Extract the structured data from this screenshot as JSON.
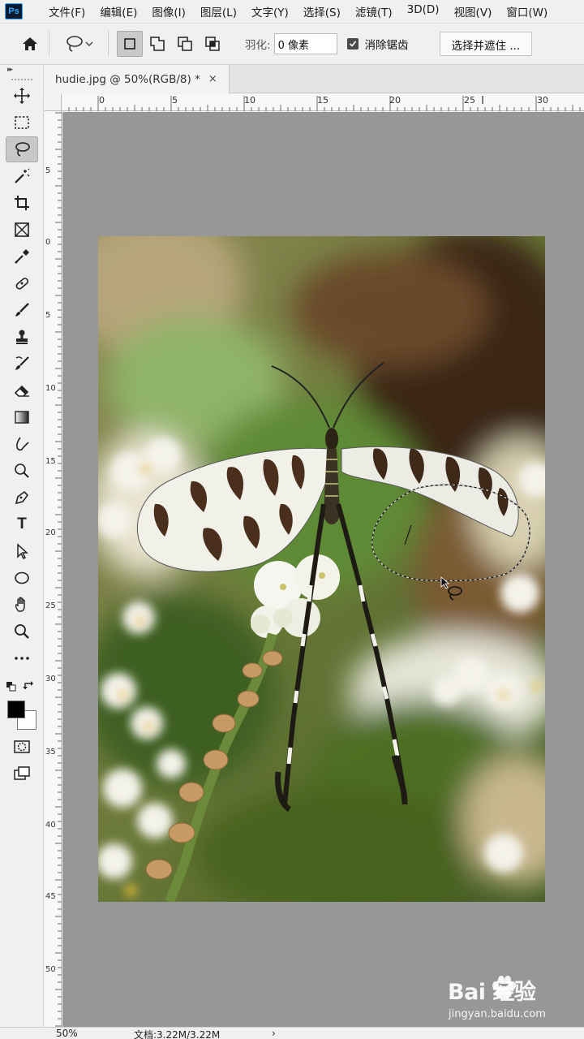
{
  "app": {
    "logo": "Ps"
  },
  "menu": {
    "items": [
      "文件(F)",
      "编辑(E)",
      "图像(I)",
      "图层(L)",
      "文字(Y)",
      "选择(S)",
      "滤镜(T)",
      "3D(D)",
      "视图(V)",
      "窗口(W)"
    ]
  },
  "options": {
    "home_icon": "home-icon",
    "tool_icon": "lasso-icon",
    "selection_modes": [
      "new-selection-icon",
      "add-to-selection-icon",
      "subtract-from-selection-icon",
      "intersect-selection-icon"
    ],
    "active_mode": "new-selection-icon",
    "feather_label": "羽化:",
    "feather_value": "0 像素",
    "antialias_checked": true,
    "antialias_label": "消除锯齿",
    "select_mask_button": "选择并遮住 ..."
  },
  "toolbar": {
    "grip_icon": "panel-collapse-icon",
    "tools": [
      "move-icon",
      "marquee-icon",
      "lasso-icon",
      "magic-wand-icon",
      "crop-icon",
      "frame-icon",
      "eyedropper-icon",
      "healing-brush-icon",
      "brush-icon",
      "clone-stamp-icon",
      "history-brush-icon",
      "eraser-icon",
      "gradient-icon",
      "blur-icon",
      "dodge-icon",
      "pen-icon",
      "type-icon",
      "path-selection-icon",
      "ellipse-icon",
      "hand-icon",
      "zoom-icon",
      "more-tools-icon"
    ],
    "active_tool": "lasso-icon",
    "type_tool_glyph": "T",
    "foreground_color": "#000000",
    "background_color": "#ffffff",
    "bottom_tools": [
      "quick-mask-icon",
      "screen-mode-icon"
    ]
  },
  "document": {
    "tab_label": "hudie.jpg @ 50%(RGB/8) *",
    "close_glyph": "×"
  },
  "rulers": {
    "horizontal": [
      "0",
      "5",
      "10",
      "15",
      "20",
      "25",
      "30"
    ],
    "vertical": [
      "5",
      "0",
      "5",
      "10",
      "15",
      "20",
      "",
      "25",
      "30",
      "35",
      "40",
      "45",
      "50"
    ]
  },
  "status": {
    "zoom": "50%",
    "doc_size": "文档:3.22M/3.22M",
    "arrow": "›"
  },
  "watermark": {
    "brand": "Bai 经验",
    "url": "jingyan.baidu.com"
  },
  "colors": {
    "canvas_bg": "#979797",
    "panel_bg": "#f0f0f0",
    "accent": "#31a8ff"
  }
}
